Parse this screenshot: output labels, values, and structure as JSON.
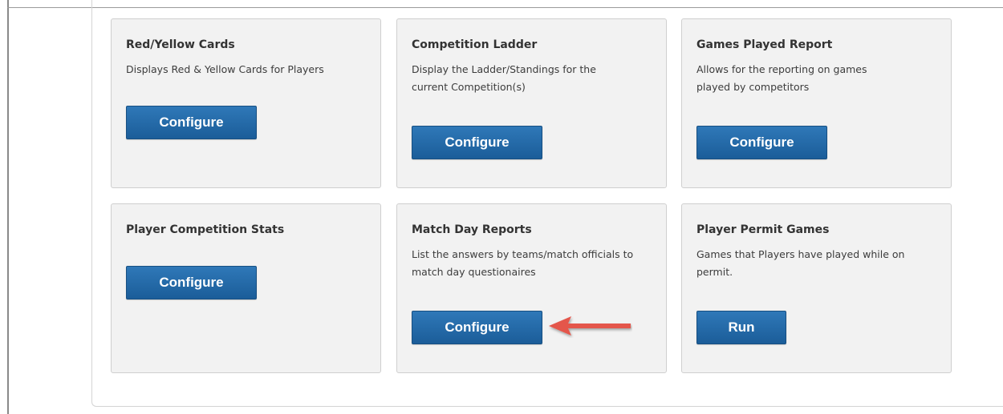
{
  "cards": [
    {
      "title": "Red/Yellow Cards",
      "description": "Displays Red & Yellow Cards for Players",
      "button_label": "Configure"
    },
    {
      "title": "Competition Ladder",
      "description": "Display the Ladder/Standings for the current Competition(s)",
      "button_label": "Configure"
    },
    {
      "title": "Games Played Report",
      "description": "Allows for the reporting on games played by competitors",
      "button_label": "Configure"
    },
    {
      "title": "Player Competition Stats",
      "description": "",
      "button_label": "Configure"
    },
    {
      "title": "Match Day Reports",
      "description": "List the answers by teams/match officials to match day questionaires",
      "button_label": "Configure"
    },
    {
      "title": "Player Permit Games",
      "description": "Games that Players have played while on permit.",
      "button_label": "Run"
    }
  ],
  "colors": {
    "button": "#1f64a3",
    "arrow": "#e4574b"
  },
  "annotation": {
    "icon": "arrow-left-icon",
    "points_to": "Match Day Reports Configure button"
  }
}
